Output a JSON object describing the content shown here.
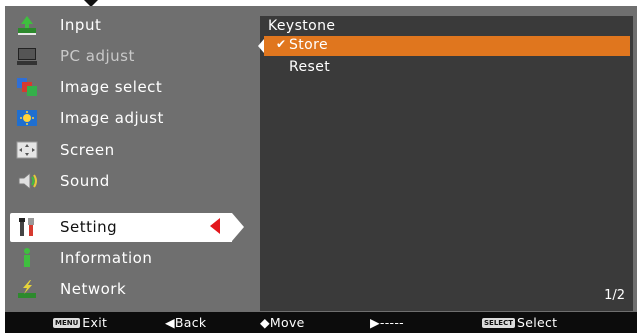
{
  "menu": {
    "items": [
      {
        "label": "Input",
        "icon": "input-icon",
        "state": "normal"
      },
      {
        "label": "PC adjust",
        "icon": "pc-adjust-icon",
        "state": "disabled"
      },
      {
        "label": "Image select",
        "icon": "image-select-icon",
        "state": "normal"
      },
      {
        "label": "Image adjust",
        "icon": "image-adjust-icon",
        "state": "normal"
      },
      {
        "label": "Screen",
        "icon": "screen-icon",
        "state": "normal"
      },
      {
        "label": "Sound",
        "icon": "sound-icon",
        "state": "normal"
      },
      {
        "label": "Setting",
        "icon": "setting-icon",
        "state": "selected"
      },
      {
        "label": "Information",
        "icon": "information-icon",
        "state": "normal"
      },
      {
        "label": "Network",
        "icon": "network-icon",
        "state": "normal"
      }
    ]
  },
  "panel": {
    "title": "Keystone",
    "options": [
      {
        "label": "Store",
        "checked": true,
        "highlighted": true
      },
      {
        "label": "Reset",
        "checked": false,
        "highlighted": false
      }
    ],
    "page": "1/2"
  },
  "footer": {
    "exit": {
      "key": "MENU",
      "label": "Exit"
    },
    "back": "◀Back",
    "move": "◆Move",
    "next": "▶-----",
    "select": {
      "key": "SELECT",
      "label": "Select"
    }
  },
  "colors": {
    "frame": "#6f6f6f",
    "panel": "#3a3a3a",
    "highlight": "#e0761e",
    "pointer": "#e3161b",
    "footer": "#0c0c0c"
  }
}
